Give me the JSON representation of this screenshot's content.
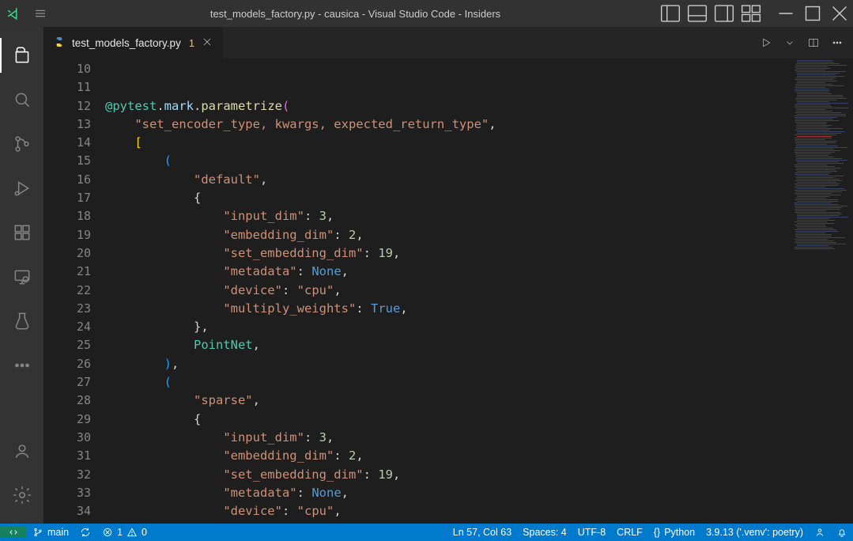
{
  "title": "test_models_factory.py - causica - Visual Studio Code - Insiders",
  "tab": {
    "filename": "test_models_factory.py",
    "dirty_indicator": "1"
  },
  "gutter": {
    "start": 10,
    "end": 34
  },
  "code_lines": [
    {
      "n": 10,
      "html": ""
    },
    {
      "n": 11,
      "html": ""
    },
    {
      "n": 12,
      "html": "<span class='tok-dec'>@pytest</span><span class='tok-punc'>.</span><span class='tok-id'>mark</span><span class='tok-punc'>.</span><span class='tok-fn'>parametrize</span><span class='tok-par'>(</span>"
    },
    {
      "n": 13,
      "html": "    <span class='tok-str'>\"set_encoder_type, kwargs, expected_return_type\"</span><span class='tok-punc'>,</span>"
    },
    {
      "n": 14,
      "html": "    <span class='tok-par2'>[</span>"
    },
    {
      "n": 15,
      "html": "        <span class='tok-par3'>(</span>"
    },
    {
      "n": 16,
      "html": "            <span class='tok-str'>\"default\"</span><span class='tok-punc'>,</span>"
    },
    {
      "n": 17,
      "html": "            <span class='tok-punc'>{</span>"
    },
    {
      "n": 18,
      "html": "                <span class='tok-str'>\"input_dim\"</span><span class='tok-punc'>:</span> <span class='tok-num'>3</span><span class='tok-punc'>,</span>"
    },
    {
      "n": 19,
      "html": "                <span class='tok-str'>\"embedding_dim\"</span><span class='tok-punc'>:</span> <span class='tok-num'>2</span><span class='tok-punc'>,</span>"
    },
    {
      "n": 20,
      "html": "                <span class='tok-str'>\"set_embedding_dim\"</span><span class='tok-punc'>:</span> <span class='tok-num'>19</span><span class='tok-punc'>,</span>"
    },
    {
      "n": 21,
      "html": "                <span class='tok-str'>\"metadata\"</span><span class='tok-punc'>:</span> <span class='tok-kw'>None</span><span class='tok-punc'>,</span>"
    },
    {
      "n": 22,
      "html": "                <span class='tok-str'>\"device\"</span><span class='tok-punc'>:</span> <span class='tok-str'>\"cpu\"</span><span class='tok-punc'>,</span>"
    },
    {
      "n": 23,
      "html": "                <span class='tok-str'>\"multiply_weights\"</span><span class='tok-punc'>:</span> <span class='tok-kw'>True</span><span class='tok-punc'>,</span>"
    },
    {
      "n": 24,
      "html": "            <span class='tok-punc'>},</span>"
    },
    {
      "n": 25,
      "html": "            <span class='tok-dec'>PointNet</span><span class='tok-punc'>,</span>"
    },
    {
      "n": 26,
      "html": "        <span class='tok-par3'>)</span><span class='tok-punc'>,</span>"
    },
    {
      "n": 27,
      "html": "        <span class='tok-par3'>(</span>"
    },
    {
      "n": 28,
      "html": "            <span class='tok-str'>\"sparse\"</span><span class='tok-punc'>,</span>"
    },
    {
      "n": 29,
      "html": "            <span class='tok-punc'>{</span>"
    },
    {
      "n": 30,
      "html": "                <span class='tok-str'>\"input_dim\"</span><span class='tok-punc'>:</span> <span class='tok-num'>3</span><span class='tok-punc'>,</span>"
    },
    {
      "n": 31,
      "html": "                <span class='tok-str'>\"embedding_dim\"</span><span class='tok-punc'>:</span> <span class='tok-num'>2</span><span class='tok-punc'>,</span>"
    },
    {
      "n": 32,
      "html": "                <span class='tok-str'>\"set_embedding_dim\"</span><span class='tok-punc'>:</span> <span class='tok-num'>19</span><span class='tok-punc'>,</span>"
    },
    {
      "n": 33,
      "html": "                <span class='tok-str'>\"metadata\"</span><span class='tok-punc'>:</span> <span class='tok-kw'>None</span><span class='tok-punc'>,</span>"
    },
    {
      "n": 34,
      "html": "                <span class='tok-str'>\"device\"</span><span class='tok-punc'>:</span> <span class='tok-str'>\"cpu\"</span><span class='tok-punc'>,</span>"
    }
  ],
  "status": {
    "branch": "main",
    "errors": "1",
    "warnings": "0",
    "cursor": "Ln 57, Col 63",
    "spaces": "Spaces: 4",
    "encoding": "UTF-8",
    "eol": "CRLF",
    "lang_mode_icon": "{}",
    "language": "Python",
    "interpreter": "3.9.13 ('.venv': poetry)"
  }
}
